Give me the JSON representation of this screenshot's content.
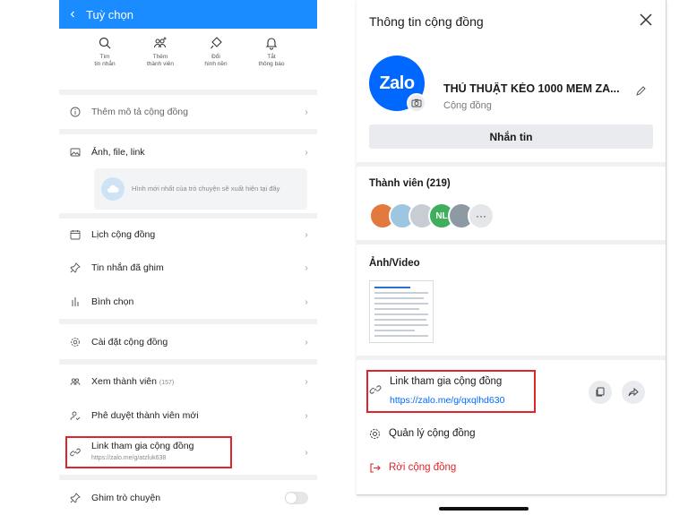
{
  "left": {
    "header_title": "Tuỳ chọn",
    "quick_actions": [
      {
        "icon": "search-icon",
        "label": "Tìm\ntin nhắn"
      },
      {
        "icon": "add-member-icon",
        "label": "Thêm\nthành viên"
      },
      {
        "icon": "paint-brush-icon",
        "label": "Đổi\nhình nền"
      },
      {
        "icon": "bell-icon",
        "label": "Tắt\nthông báo"
      }
    ],
    "add_description": "Thêm mô tả cộng đồng",
    "media": "Ảnh, file, link",
    "media_empty": "Hình mới nhất của trò chuyện sẽ xuất hiện tại đây",
    "calendar": "Lịch cộng đồng",
    "pinned": "Tin nhắn đã ghim",
    "poll": "Bình chọn",
    "settings": "Cài đặt cộng đồng",
    "members_label": "Xem thành viên",
    "members_count": "(157)",
    "approve": "Phê duyệt thành viên mới",
    "link_title": "Link tham gia cộng đồng",
    "link_url": "https://zalo.me/g/atzluk638",
    "pin_chat": "Ghim trò chuyện"
  },
  "right": {
    "title": "Thông tin cộng đồng",
    "logo_text": "Zalo",
    "group_name": "THỦ THUẬT KÉO 1000 MEM ZA...",
    "group_type": "Cộng đồng",
    "message_button": "Nhắn tin",
    "members_header": "Thành viên (219)",
    "avatar_initials": "NL",
    "avatar_more": "···",
    "media_header": "Ảnh/Video",
    "link_title": "Link tham gia cộng đồng",
    "link_url": "https://zalo.me/g/qxqlhd630",
    "manage": "Quản lý cộng đồng",
    "leave": "Rời cộng đồng"
  },
  "colors": {
    "zalo_blue": "#0068ff",
    "header_blue": "#1a8cff",
    "highlight_red": "#e0242c",
    "leave_red": "#e0242c"
  }
}
